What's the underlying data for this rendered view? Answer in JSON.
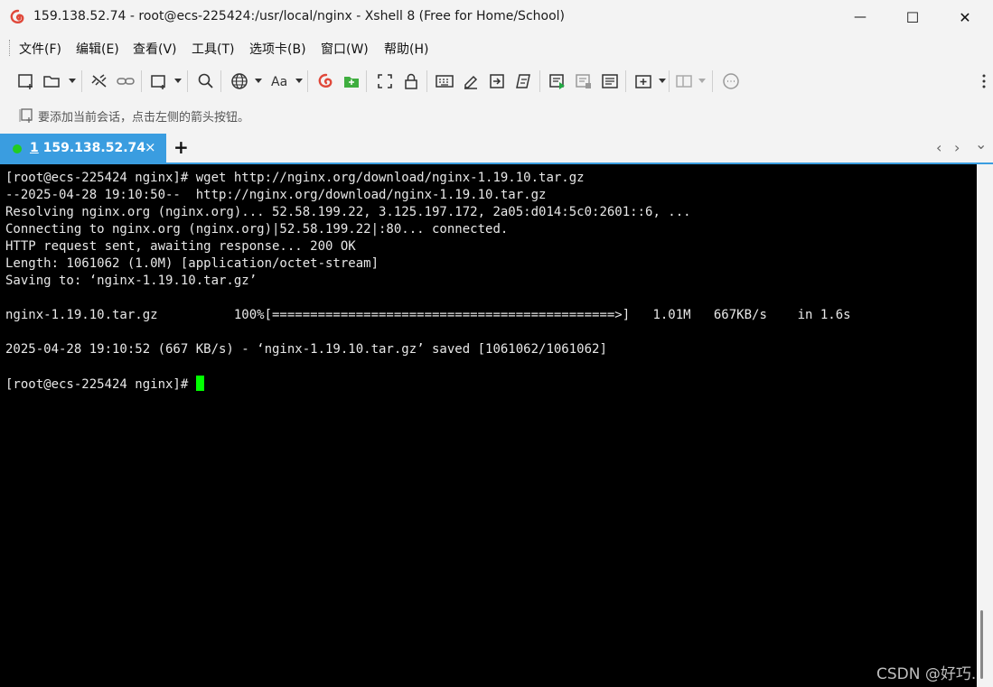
{
  "window": {
    "title": "159.138.52.74 - root@ecs-225424:/usr/local/nginx - Xshell 8 (Free for Home/School)",
    "minimize_glyph": "—",
    "maximize_glyph": "☐",
    "close_glyph": "✕"
  },
  "menu": {
    "items": [
      "文件(F)",
      "编辑(E)",
      "查看(V)",
      "工具(T)",
      "选项卡(B)",
      "窗口(W)",
      "帮助(H)"
    ]
  },
  "toolbar": {
    "icons": [
      "new-session-icon",
      "open-folder-icon",
      "disconnect-icon",
      "reconnect-icon",
      "new-window-icon",
      "find-icon",
      "globe-icon",
      "font-icon",
      "xshell-icon",
      "xftp-icon",
      "fullscreen-icon",
      "lock-icon",
      "keyboard-icon",
      "highlight-icon",
      "send-icon",
      "script-icon",
      "record-icon",
      "stop-icon",
      "log-icon",
      "new-tab-icon",
      "layout-icon",
      "chat-icon"
    ]
  },
  "hint": {
    "text": "要添加当前会话，点击左侧的箭头按钮。"
  },
  "tabs": {
    "active": {
      "number": "1",
      "label": " 159.138.52.74",
      "status_color": "#22cc22"
    },
    "close_glyph": "×",
    "add_glyph": "+",
    "prev_glyph": "‹",
    "next_glyph": "›",
    "menu_glyph": "⌄"
  },
  "terminal": {
    "lines": [
      "[root@ecs-225424 nginx]# wget http://nginx.org/download/nginx-1.19.10.tar.gz",
      "--2025-04-28 19:10:50--  http://nginx.org/download/nginx-1.19.10.tar.gz",
      "Resolving nginx.org (nginx.org)... 52.58.199.22, 3.125.197.172, 2a05:d014:5c0:2601::6, ...",
      "Connecting to nginx.org (nginx.org)|52.58.199.22|:80... connected.",
      "HTTP request sent, awaiting response... 200 OK",
      "Length: 1061062 (1.0M) [application/octet-stream]",
      "Saving to: ‘nginx-1.19.10.tar.gz’",
      "",
      "nginx-1.19.10.tar.gz          100%[=============================================>]   1.01M   667KB/s    in 1.6s",
      "",
      "2025-04-28 19:10:52 (667 KB/s) - ‘nginx-1.19.10.tar.gz’ saved [1061062/1061062]",
      "",
      "[root@ecs-225424 nginx]# "
    ],
    "background": "#000000",
    "foreground": "#e8e8e8",
    "cursor_color": "#00ff00"
  },
  "watermark": {
    "text": "CSDN @好巧."
  }
}
